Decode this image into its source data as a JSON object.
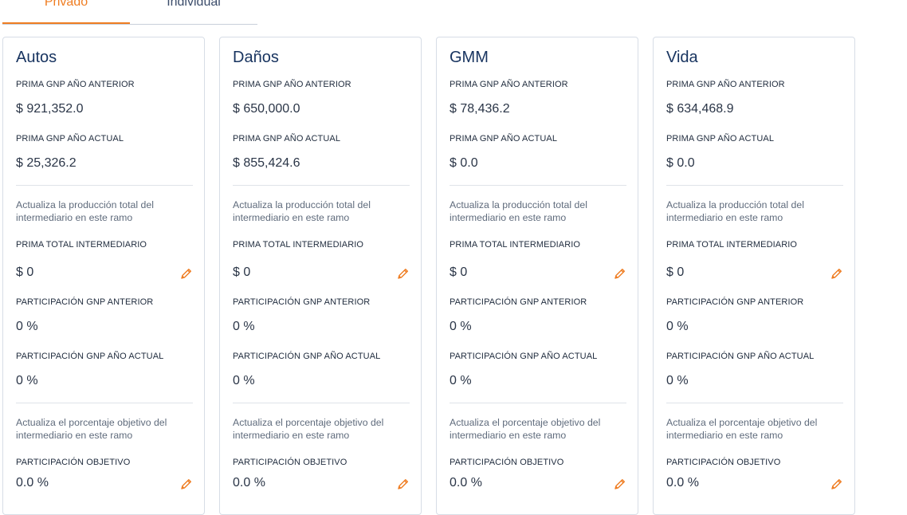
{
  "tabs": [
    {
      "label": "Privado"
    },
    {
      "label": "Individual"
    }
  ],
  "labels": {
    "prima_anterior": "PRIMA GNP AÑO ANTERIOR",
    "prima_actual": "PRIMA GNP AÑO ACTUAL",
    "desc_produccion": "Actualiza la producción total del intermediario en este ramo",
    "prima_total": "PRIMA TOTAL INTERMEDIARIO",
    "part_anterior": "PARTICIPACIÓN GNP ANTERIOR",
    "part_actual": "PARTICIPACIÓN GNP AÑO ACTUAL",
    "desc_objetivo": "Actualiza el porcentaje objetivo del intermediario en este ramo",
    "part_objetivo": "PARTICIPACIÓN OBJETIVO"
  },
  "cards": [
    {
      "title": "Autos",
      "prima_anterior": "$ 921,352.0",
      "prima_actual": "$ 25,326.2",
      "prima_total": "$ 0",
      "part_anterior": "0 %",
      "part_actual": "0 %",
      "part_objetivo": "0.0 %"
    },
    {
      "title": "Daños",
      "prima_anterior": "$ 650,000.0",
      "prima_actual": "$ 855,424.6",
      "prima_total": "$ 0",
      "part_anterior": "0 %",
      "part_actual": "0 %",
      "part_objetivo": "0.0 %"
    },
    {
      "title": "GMM",
      "prima_anterior": "$ 78,436.2",
      "prima_actual": "$ 0.0",
      "prima_total": "$ 0",
      "part_anterior": "0 %",
      "part_actual": "0 %",
      "part_objetivo": "0.0 %"
    },
    {
      "title": "Vida",
      "prima_anterior": "$ 634,468.9",
      "prima_actual": "$ 0.0",
      "prima_total": "$ 0",
      "part_anterior": "0 %",
      "part_actual": "0 %",
      "part_objetivo": "0.0 %"
    }
  ],
  "colors": {
    "accent": "#ef7d22",
    "title": "#17335f"
  }
}
